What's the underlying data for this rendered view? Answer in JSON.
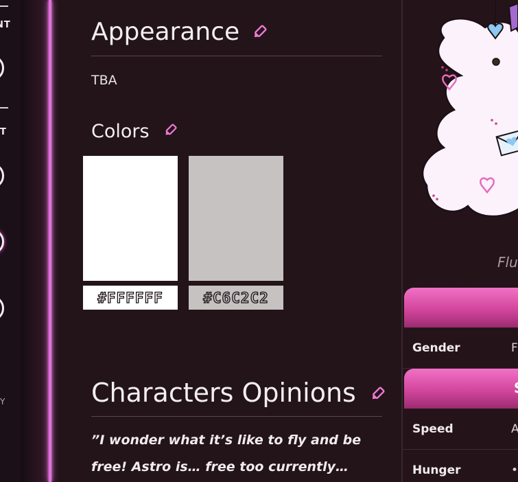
{
  "left_rail": {
    "label_top": "NT",
    "label_second": "T",
    "label_bottom": "Y"
  },
  "appearance": {
    "title": "Appearance",
    "text": "TBA"
  },
  "colors": {
    "title": "Colors",
    "swatches": [
      {
        "hex": "#FFFFFF",
        "color": "#ffffff"
      },
      {
        "hex": "#C6C2C2",
        "color": "#c6c2c2"
      }
    ]
  },
  "opinions": {
    "title": "Characters Opinions",
    "quote_line1": "”I wonder what it’s like to fly and be",
    "quote_line2": "free! Astro is… free too currently…"
  },
  "right_panel": {
    "caption": "Flu",
    "header1_text": "",
    "header2_text": "S",
    "rows": [
      {
        "label": "Gender",
        "value": "F"
      },
      {
        "label": "Speed",
        "value": "A"
      },
      {
        "label": "Hunger",
        "value": "•"
      }
    ]
  },
  "accent_color": "#e26fe0"
}
